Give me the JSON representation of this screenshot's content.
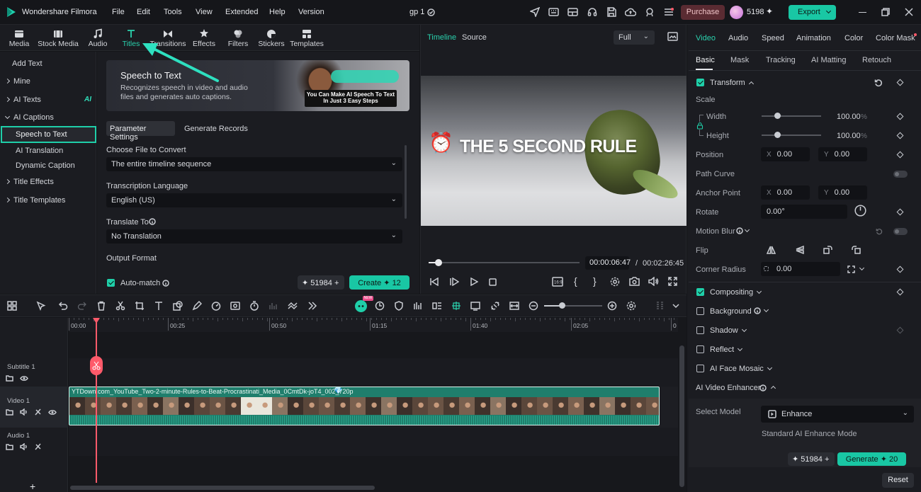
{
  "app": {
    "name": "Wondershare Filmora",
    "project": "gp 1"
  },
  "menu": [
    "File",
    "Edit",
    "Tools",
    "View",
    "Extended",
    "Help",
    "Version"
  ],
  "topbar": {
    "purchase": "Purchase",
    "credits": "5198",
    "export": "Export"
  },
  "media_tabs": [
    {
      "label": "Media",
      "icon": "media-icon"
    },
    {
      "label": "Stock Media",
      "icon": "stock-media-icon"
    },
    {
      "label": "Audio",
      "icon": "audio-icon"
    },
    {
      "label": "Titles",
      "icon": "titles-icon"
    },
    {
      "label": "Transitions",
      "icon": "transitions-icon"
    },
    {
      "label": "Effects",
      "icon": "effects-icon"
    },
    {
      "label": "Filters",
      "icon": "filters-icon"
    },
    {
      "label": "Stickers",
      "icon": "stickers-icon"
    },
    {
      "label": "Templates",
      "icon": "templates-icon"
    }
  ],
  "sidebar": {
    "add_text": "Add Text",
    "mine": "Mine",
    "ai_texts": "AI Texts",
    "ai_badge": "AI",
    "ai_captions": "AI Captions",
    "speech_to_text": "Speech to Text",
    "ai_translation": "AI Translation",
    "dynamic_caption": "Dynamic Caption",
    "title_effects": "Title Effects",
    "title_templates": "Title Templates"
  },
  "banner": {
    "title": "Speech to Text",
    "desc1": "Recognizes speech in video and audio",
    "desc2": "files and generates auto captions.",
    "caption1": "You Can Make AI Speech To Text",
    "caption2": "In Just  3 Easy Steps"
  },
  "stt": {
    "tab_params": "Parameter Settings",
    "tab_records": "Generate Records",
    "file_label": "Choose File to Convert",
    "file_value": "The entire timeline sequence",
    "lang_label": "Transcription Language",
    "lang_value": "English (US)",
    "translate_label": "Translate To",
    "translate_value": "No Translation",
    "output_label": "Output Format",
    "automatch": "Auto-match",
    "credits": "51984",
    "create": "Create",
    "create_cost": "12"
  },
  "player": {
    "tab_timeline": "Timeline",
    "tab_source": "Source",
    "zoom": "Full",
    "overlay_text": "THE 5 SECOND RULE",
    "current_time": "00:00:06:47",
    "separator": "/",
    "total_time": "00:02:26:45",
    "progress": 0.06
  },
  "props": {
    "tabs": [
      "Video",
      "Audio",
      "Speed",
      "Animation",
      "Color",
      "Color Mask"
    ],
    "subtabs": [
      "Basic",
      "Mask",
      "Tracking",
      "AI Matting",
      "Retouch"
    ],
    "transform": "Transform",
    "scale": "Scale",
    "width": "Width",
    "width_val": "100.00",
    "height": "Height",
    "height_val": "100.00",
    "pct": "%",
    "position": "Position",
    "x_label": "X",
    "y_label": "Y",
    "pos_x": "0.00",
    "pos_y": "0.00",
    "path_curve": "Path Curve",
    "anchor_point": "Anchor Point",
    "anc_x": "0.00",
    "anc_y": "0.00",
    "rotate": "Rotate",
    "rotate_val": "0.00°",
    "motion_blur": "Motion Blur",
    "flip": "Flip",
    "corner_radius": "Corner Radius",
    "corner_val": "0.00",
    "compositing": "Compositing",
    "background": "Background",
    "shadow": "Shadow",
    "reflect": "Reflect",
    "ai_face_mosaic": "AI Face Mosaic",
    "ai_video_enhancer": "AI Video Enhancer",
    "select_model": "Select Model",
    "model_value": "Enhance",
    "mode_desc": "Standard AI Enhance Mode",
    "credits": "51984",
    "generate": "Generate",
    "generate_cost": "20",
    "reset": "Reset"
  },
  "timeline": {
    "ruler": [
      "00:00",
      "00:25",
      "00:50",
      "01:15",
      "01:40",
      "02:05",
      "0"
    ],
    "new_badge": "NEW",
    "tracks": {
      "subtitle": "Subtitle 1",
      "video": "Video 1",
      "audio": "Audio 1"
    },
    "clip_name": "YTDown.com_YouTube_Two-2-minute-Rules-to-Beat-Procrastinati_Media_0CmtDk-joT4_002_720p"
  },
  "colors": {
    "accent": "#19c7a4",
    "playhead": "#ff5a6a",
    "purchase": "#5a2b32",
    "clip": "#1f7e6c"
  }
}
